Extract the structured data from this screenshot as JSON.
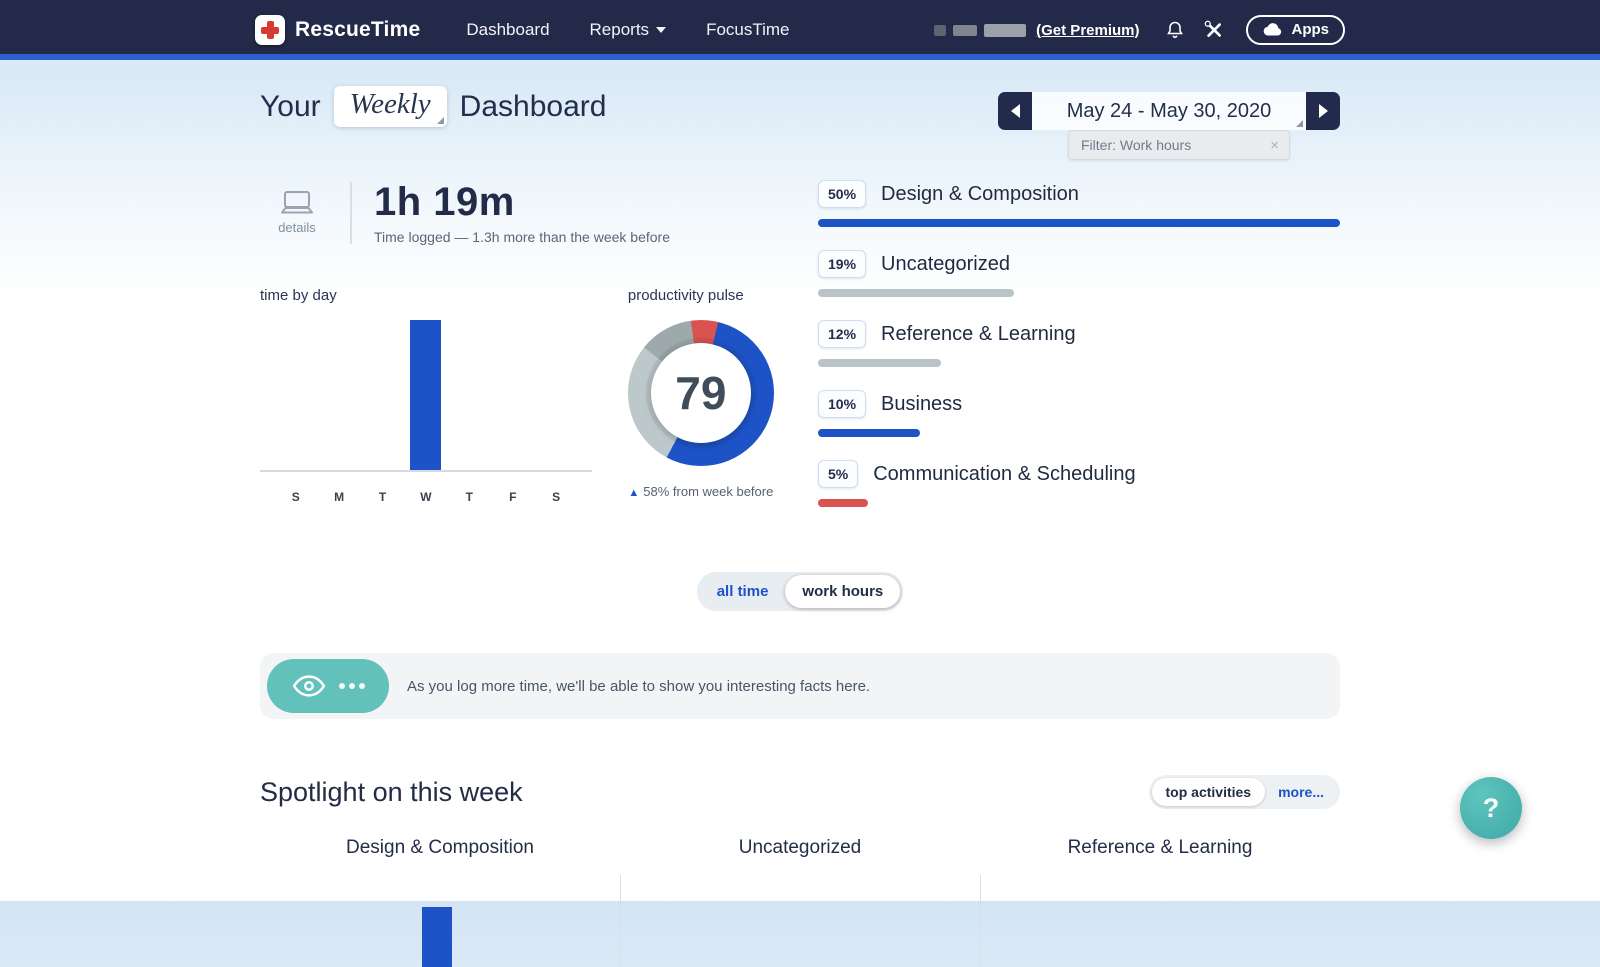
{
  "colors": {
    "accent": "#1d53c7",
    "red": "#d9534f",
    "gray_bar": "#b9c4c9",
    "pulse_light": "#bcc8c9",
    "pulse_mid": "#9da9ab",
    "teal": "#63c1bb",
    "navy": "#232949"
  },
  "navbar": {
    "brand": "RescueTime",
    "links": [
      {
        "label": "Dashboard"
      },
      {
        "label": "Reports"
      },
      {
        "label": "FocusTime"
      }
    ],
    "premium_link": "(Get Premium)",
    "apps_label": "Apps"
  },
  "icons": {
    "notifications": "bell-icon",
    "settings": "tools-icon",
    "apps": "cloud-icon",
    "summary": "laptop-icon",
    "insight": "eye-icon"
  },
  "header": {
    "title_prefix": "Your",
    "period": "Weekly",
    "title_suffix": "Dashboard",
    "date_range": "May 24 - May 30, 2020",
    "filter_label": "Filter: Work hours",
    "filter_close": "×"
  },
  "summary": {
    "details_label": "details",
    "time_logged": "1h 19m",
    "subtitle": "Time logged — 1.3h more than the week before"
  },
  "time_by_day": {
    "title": "time by day",
    "days": [
      "S",
      "M",
      "T",
      "W",
      "T",
      "F",
      "S"
    ],
    "values": [
      0,
      0,
      0,
      1.32,
      0,
      0,
      0
    ],
    "max": 1.32
  },
  "productivity_pulse": {
    "title": "productivity pulse",
    "score": "79",
    "change_arrow": "▲",
    "change_text": "58% from week before",
    "start_angle": -8,
    "segments": [
      {
        "color": "red",
        "pct": 6
      },
      {
        "color": "accent",
        "pct": 54
      },
      {
        "color": "pulse_light",
        "pct": 28
      },
      {
        "color": "pulse_mid",
        "pct": 12
      }
    ]
  },
  "categories": [
    {
      "percent": "50%",
      "label": "Design & Composition",
      "bar_width_pct": 100,
      "color": "accent"
    },
    {
      "percent": "19%",
      "label": "Uncategorized",
      "bar_width_pct": 37.5,
      "color": "gray_bar"
    },
    {
      "percent": "12%",
      "label": "Reference & Learning",
      "bar_width_pct": 23.5,
      "color": "gray_bar"
    },
    {
      "percent": "10%",
      "label": "Business",
      "bar_width_pct": 19.5,
      "color": "accent"
    },
    {
      "percent": "5%",
      "label": "Communication & Scheduling",
      "bar_width_pct": 9.5,
      "color": "red"
    }
  ],
  "scope_toggle": {
    "all_time": "all time",
    "work_hours": "work hours"
  },
  "info_banner": {
    "text": "As you log more time, we'll be able to show you interesting facts here."
  },
  "spotlight": {
    "title": "Spotlight on this week",
    "top_activities": "top activities",
    "more": "more...",
    "columns": [
      {
        "label": "Design & Composition"
      },
      {
        "label": "Uncategorized"
      },
      {
        "label": "Reference & Learning"
      }
    ]
  },
  "help_button": "?"
}
